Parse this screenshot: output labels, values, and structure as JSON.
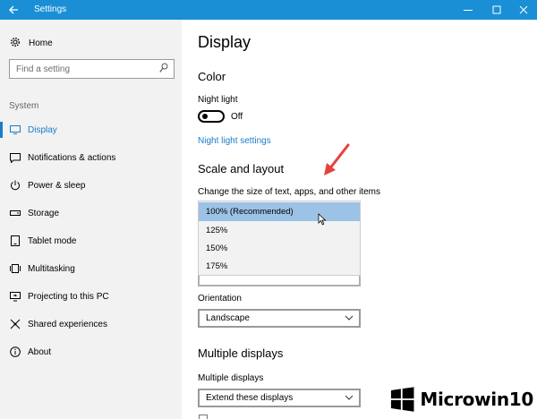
{
  "window": {
    "title": "Settings"
  },
  "sidebar": {
    "home_label": "Home",
    "search_placeholder": "Find a setting",
    "group_label": "System",
    "items": [
      {
        "label": "Display",
        "icon": "monitor-icon",
        "active": true
      },
      {
        "label": "Notifications & actions",
        "icon": "notification-icon"
      },
      {
        "label": "Power & sleep",
        "icon": "power-icon"
      },
      {
        "label": "Storage",
        "icon": "storage-icon"
      },
      {
        "label": "Tablet mode",
        "icon": "tablet-icon"
      },
      {
        "label": "Multitasking",
        "icon": "multitasking-icon"
      },
      {
        "label": "Projecting to this PC",
        "icon": "projecting-icon"
      },
      {
        "label": "Shared experiences",
        "icon": "shared-icon"
      },
      {
        "label": "About",
        "icon": "info-icon"
      }
    ]
  },
  "main": {
    "title": "Display",
    "color_section": "Color",
    "night_light_label": "Night light",
    "night_light_state": "Off",
    "night_light_link": "Night light settings",
    "scale_section": "Scale and layout",
    "scale_label": "Change the size of text, apps, and other items",
    "scale_options": [
      "100% (Recommended)",
      "125%",
      "150%",
      "175%"
    ],
    "scale_selected": "100% (Recommended)",
    "orientation_label": "Orientation",
    "orientation_value": "Landscape",
    "multiple_section": "Multiple displays",
    "multiple_label": "Multiple displays",
    "multiple_value": "Extend these displays"
  },
  "watermark": {
    "text": "Microwin10"
  },
  "colors": {
    "titlebar": "#1a8fd6",
    "accent": "#1a7cc9",
    "selected_option": "#9cc2e5",
    "annotation_arrow": "#e8413c"
  }
}
